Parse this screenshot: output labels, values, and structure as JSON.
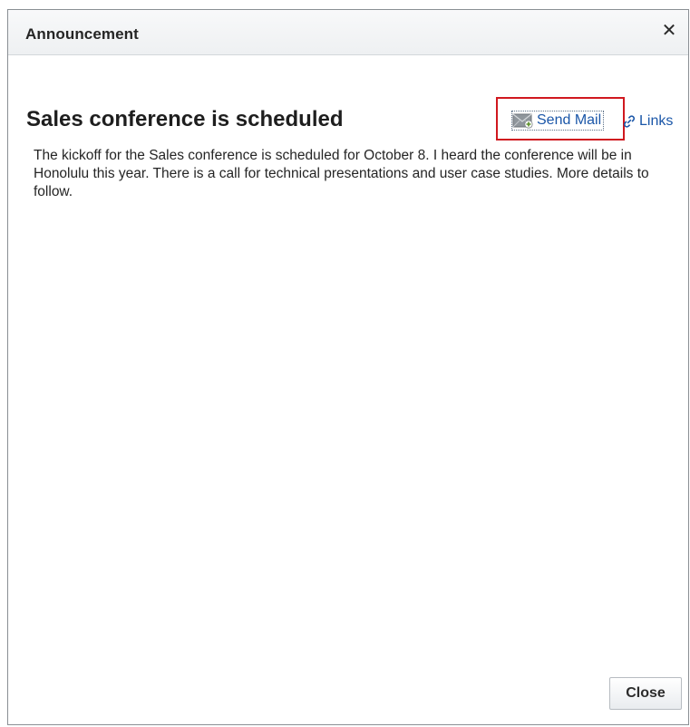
{
  "dialog": {
    "title": "Announcement",
    "close_icon": "close-icon"
  },
  "announcement": {
    "headline": "Sales conference is scheduled",
    "send_mail_label": "Send Mail",
    "links_label": "Links",
    "body": "The kickoff for the Sales conference is scheduled for October 8. I heard the conference will be in Honolulu this year. There is a call for technical presentations and user case studies. More details to follow."
  },
  "footer": {
    "close_label": "Close"
  },
  "colors": {
    "link": "#1a56a8",
    "highlight": "#d0181f"
  }
}
